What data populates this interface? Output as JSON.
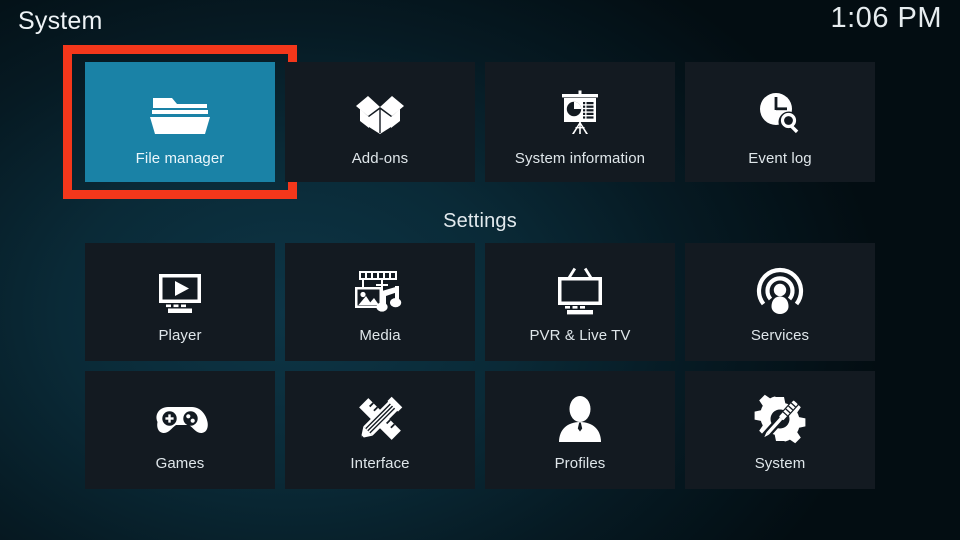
{
  "header": {
    "title": "System",
    "clock": "1:06 PM"
  },
  "settings_heading": "Settings",
  "colors": {
    "selected_tile_bg": "#1a82a6",
    "focus_ring": "#f4371b",
    "tile_bg": "#131a21",
    "background_teal": "#0d3546",
    "text": "#e9eef1"
  },
  "top_row": [
    {
      "label": "File manager",
      "icon": "folder-icon",
      "selected": true
    },
    {
      "label": "Add-ons",
      "icon": "open-box-icon",
      "selected": false
    },
    {
      "label": "System information",
      "icon": "presentation-icon",
      "selected": false
    },
    {
      "label": "Event log",
      "icon": "clock-search-icon",
      "selected": false
    }
  ],
  "settings_row": [
    {
      "label": "Player",
      "icon": "monitor-play-icon"
    },
    {
      "label": "Media",
      "icon": "filmstrip-photo-music-icon"
    },
    {
      "label": "PVR & Live TV",
      "icon": "tv-antenna-icon"
    },
    {
      "label": "Services",
      "icon": "broadcast-person-icon"
    },
    {
      "label": "Games",
      "icon": "gamepad-icon"
    },
    {
      "label": "Interface",
      "icon": "pencil-ruler-icon"
    },
    {
      "label": "Profiles",
      "icon": "person-bust-icon"
    },
    {
      "label": "System",
      "icon": "gear-screwdriver-icon"
    }
  ]
}
